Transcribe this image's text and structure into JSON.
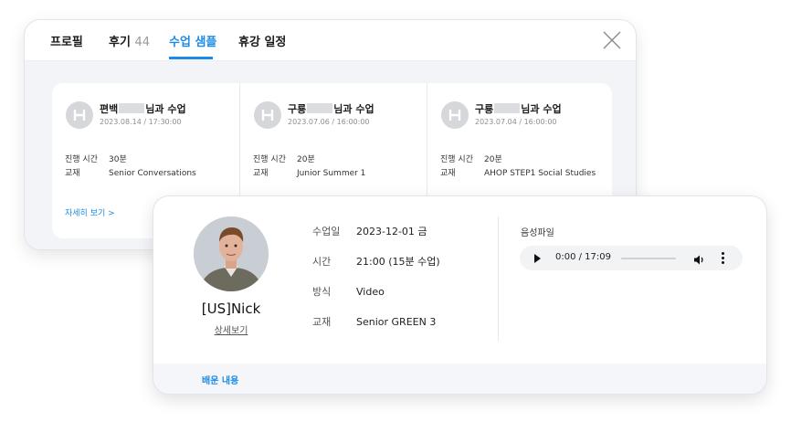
{
  "tabs": [
    {
      "label": "프로필",
      "count": ""
    },
    {
      "label": "후기",
      "count": "44"
    },
    {
      "label": "수업 샘플",
      "count": ""
    },
    {
      "label": "휴강 일정",
      "count": ""
    }
  ],
  "active_tab": "수업 샘플",
  "lessons": [
    {
      "name_prefix": "편백",
      "name_suffix": "님과 수업",
      "datetime": "2023.08.14 / 17:30:00",
      "duration_label": "진행 시간",
      "duration": "30분",
      "material_label": "교재",
      "material": "Senior Conversations"
    },
    {
      "name_prefix": "구룡",
      "name_suffix": "님과 수업",
      "datetime": "2023.07.06 / 16:00:00",
      "duration_label": "진행 시간",
      "duration": "20분",
      "material_label": "교재",
      "material": "Junior Summer 1"
    },
    {
      "name_prefix": "구룡",
      "name_suffix": "님과 수업",
      "datetime": "2023.07.04 / 16:00:00",
      "duration_label": "진행 시간",
      "duration": "20분",
      "material_label": "교재",
      "material": "AHOP STEP1 Social Studies"
    }
  ],
  "more_link": "자세히 보기 >",
  "detail": {
    "tutor_name": "[US]Nick",
    "tutor_detail_link": "상세보기",
    "info": [
      {
        "label": "수업일",
        "value": "2023-12-01 금"
      },
      {
        "label": "시간",
        "value": "21:00 (15분 수업)"
      },
      {
        "label": "방식",
        "value": "Video"
      },
      {
        "label": "교재",
        "value": "Senior GREEN 3"
      }
    ],
    "audio_label": "음성파일",
    "audio_time": "0:00 / 17:09",
    "audio_progress": 0,
    "learned_label": "배운 내용"
  },
  "colors": {
    "accent": "#1a8be8",
    "panel_bg": "#f3f4f8"
  },
  "icons": [
    "close-icon",
    "play-icon",
    "volume-icon",
    "more-vert-icon",
    "tutor-logo-icon"
  ]
}
